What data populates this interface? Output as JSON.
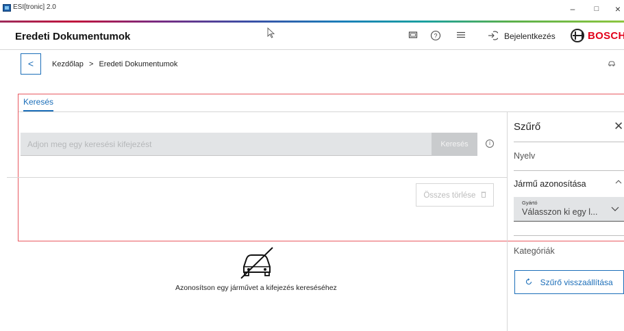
{
  "window": {
    "title": "ESI[tronic] 2.0",
    "minimize": "–",
    "restore": "□",
    "close": "×"
  },
  "header": {
    "page_title": "Eredeti Dokumentumok",
    "login_label": "Bejelentkezés",
    "brand": "BOSCH"
  },
  "header_icons": [
    "screen-icon",
    "help-icon",
    "menu-icon",
    "login-icon"
  ],
  "breadcrumb": {
    "back": "<",
    "home": "Kezdőlap",
    "separator": ">",
    "current": "Eredeti Dokumentumok"
  },
  "tabs": [
    {
      "label": "Keresés",
      "active": true
    }
  ],
  "search": {
    "placeholder": "Adjon meg egy keresési kifejezést",
    "button_label": "Keresés",
    "clear_all_label": "Összes törlése"
  },
  "filter": {
    "title": "Szűrő",
    "language_label": "Nyelv",
    "vehicle_id_label": "Jármű azonosítása",
    "manufacturer_label": "Gyártó",
    "manufacturer_value": "Válasszon ki egy l...",
    "categories_label": "Kategóriák",
    "reset_label": "Szűrő visszaállítása"
  },
  "empty_state": {
    "message": "Azonosítson egy járművet a kifejezés kereséséhez"
  },
  "colors": {
    "accent": "#1a6db8",
    "brand_red": "#e2001a",
    "highlight_frame": "#e8585f"
  }
}
